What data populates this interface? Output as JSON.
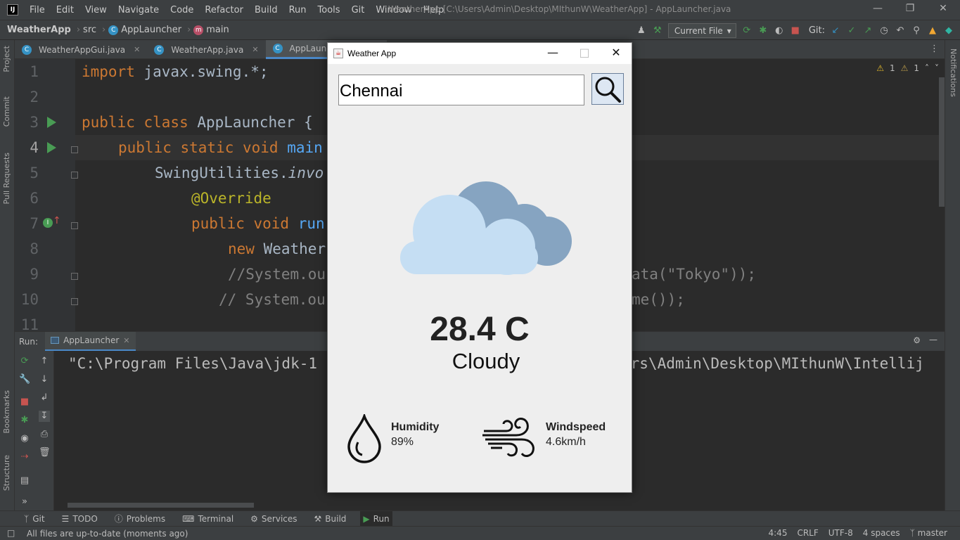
{
  "menubar": {
    "logo": "IJ",
    "items": [
      "File",
      "Edit",
      "View",
      "Navigate",
      "Code",
      "Refactor",
      "Build",
      "Run",
      "Tools",
      "Git",
      "Window",
      "Help"
    ],
    "window_title": "WeatherApp [C:\\Users\\Admin\\Desktop\\MIthunW\\WeatherApp] - AppLauncher.java"
  },
  "navbar": {
    "project": "WeatherApp",
    "folder": "src",
    "class": "AppLauncher",
    "method": "main",
    "run_config": "Current File",
    "git_label": "Git:"
  },
  "editor_tabs": [
    {
      "label": "WeatherAppGui.java"
    },
    {
      "label": "WeatherApp.java"
    },
    {
      "label": "AppLauncher.java"
    }
  ],
  "editor": {
    "line_numbers": [
      "1",
      "2",
      "3",
      "4",
      "5",
      "6",
      "7",
      "8",
      "9",
      "10",
      "11"
    ],
    "warnings": "1",
    "weak_warnings": "1",
    "lines": {
      "l1_kw": "import",
      "l1_rest": " javax.swing.*;",
      "l3_kw": "public class",
      "l3_name": " AppLauncher ",
      "l3_brace": "{",
      "l4_kw": "public static void",
      "l4_name": " main",
      "l5_a": "SwingUtilities.",
      "l5_b": "invo",
      "l6": "@Override",
      "l7_kw": "public void",
      "l7_name": " run",
      "l8_kw": "new",
      "l8_rest": " Weather",
      "l9_a": "//System.ou",
      "l9_b": "ata(\"Tokyo\"));",
      "l10_a": "// System.ou",
      "l10_b": "me());"
    }
  },
  "run_panel": {
    "label": "Run:",
    "tab": "AppLauncher",
    "console_left": "\"C:\\Program Files\\Java\\jdk-1",
    "console_right": "ers\\Admin\\Desktop\\MIthunW\\Intellij"
  },
  "left_strip": {
    "project": "Project",
    "commit": "Commit",
    "pull_requests": "Pull Requests",
    "bookmarks": "Bookmarks",
    "structure": "Structure"
  },
  "right_strip": {
    "notifications": "Notifications"
  },
  "bottom_tools": [
    "Git",
    "TODO",
    "Problems",
    "Terminal",
    "Services",
    "Build",
    "Run"
  ],
  "status": {
    "message": "All files are up-to-date (moments ago)",
    "position": "4:45",
    "line_sep": "CRLF",
    "encoding": "UTF-8",
    "indent": "4 spaces",
    "branch": "master"
  },
  "weather_app": {
    "title": "Weather App",
    "search_value": "Chennai",
    "temperature": "28.4 C",
    "condition": "Cloudy",
    "humidity_label": "Humidity",
    "humidity_value": "89%",
    "windspeed_label": "Windspeed",
    "windspeed_value": "4.6km/h",
    "colors": {
      "cloud_front": "#c5def3",
      "cloud_back": "#86a4c1"
    }
  }
}
